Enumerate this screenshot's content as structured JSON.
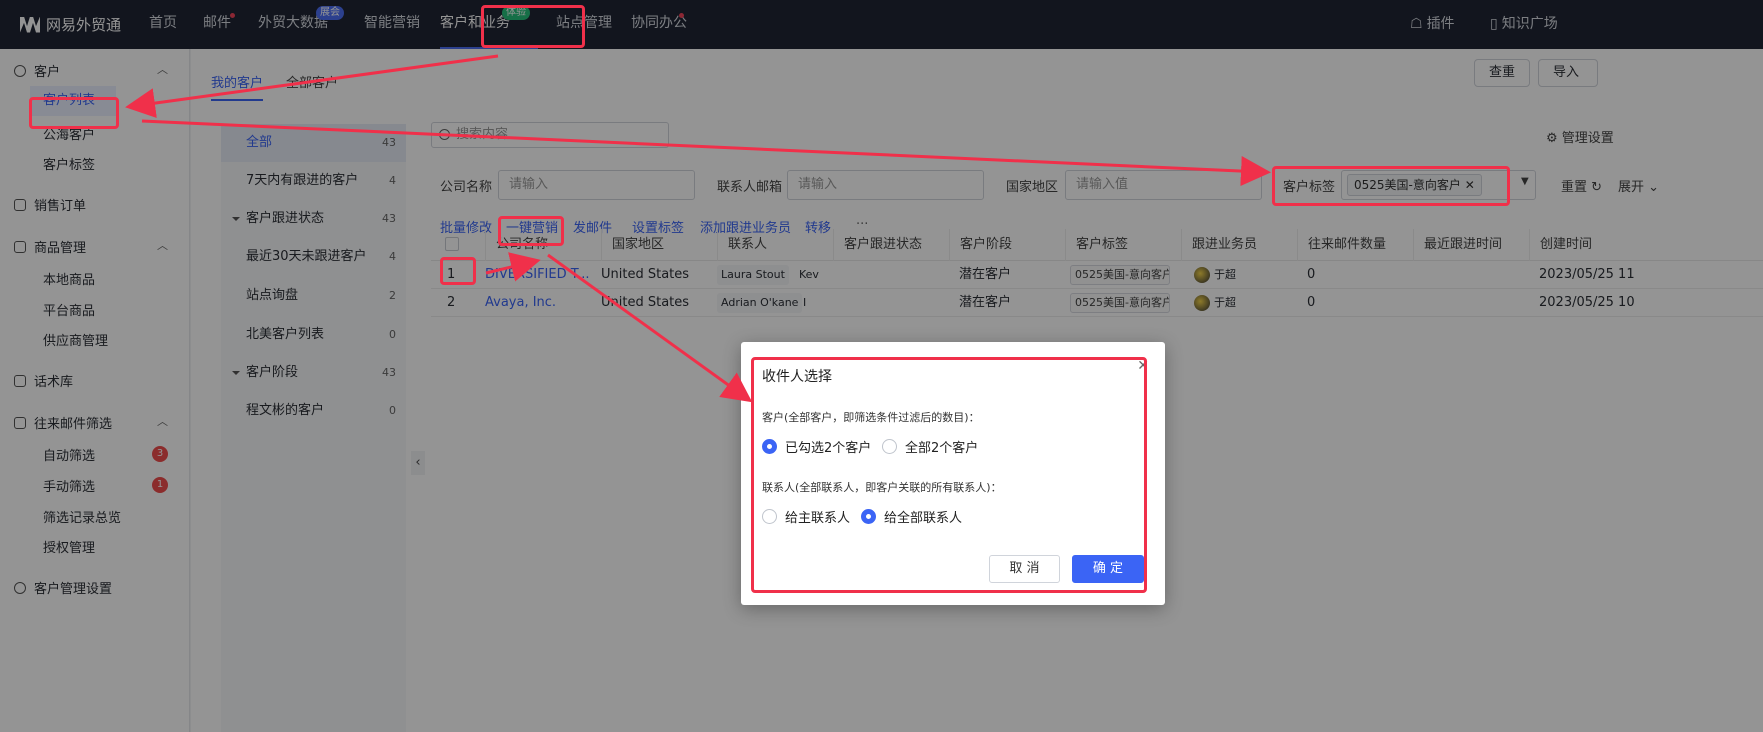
{
  "topnav": {
    "brand": "网易外贸通",
    "items": [
      {
        "label": "首页"
      },
      {
        "label": "邮件"
      },
      {
        "label": "外贸大数据",
        "badge": "展会"
      },
      {
        "label": "智能营销"
      },
      {
        "label": "客户和业务",
        "badge": "体验"
      },
      {
        "label": "站点管理"
      },
      {
        "label": "协同办公"
      }
    ],
    "right": [
      {
        "label": "插件",
        "icon": "plugin-icon"
      },
      {
        "label": "知识广场",
        "icon": "book-icon"
      }
    ]
  },
  "sidebar": {
    "groups": [
      {
        "label": "客户",
        "icon": "user-circle-icon",
        "items": [
          "客户列表",
          "公海客户",
          "客户标签"
        ]
      },
      {
        "label": "销售订单",
        "icon": "document-icon",
        "items": []
      },
      {
        "label": "商品管理",
        "icon": "box-icon",
        "items": [
          "本地商品",
          "平台商品",
          "供应商管理"
        ]
      },
      {
        "label": "话术库",
        "icon": "book-icon",
        "items": []
      },
      {
        "label": "往来邮件筛选",
        "icon": "mail-filter-icon",
        "items": [
          "自动筛选",
          "手动筛选",
          "筛选记录总览",
          "授权管理"
        ]
      },
      {
        "label": "客户管理设置",
        "icon": "gear-icon",
        "items": []
      }
    ],
    "counts": {
      "auto_filter": "3",
      "manual_filter": "1"
    }
  },
  "tabs": [
    "我的客户",
    "全部客户"
  ],
  "top_buttons": [
    "查重",
    "导入"
  ],
  "segments": [
    {
      "label": "全部",
      "count": "43"
    },
    {
      "label": "7天内有跟进的客户",
      "count": "4"
    },
    {
      "label": "客户跟进状态",
      "count": "43"
    },
    {
      "label": "最近30天未跟进客户",
      "count": "4"
    },
    {
      "label": "站点询盘",
      "count": "2"
    },
    {
      "label": "北美客户列表",
      "count": "0"
    },
    {
      "label": "客户阶段",
      "count": "43"
    },
    {
      "label": "程文彬的客户",
      "count": "0"
    }
  ],
  "search": {
    "placeholder": "搜索内容"
  },
  "manage_settings": "管理设置",
  "filters": {
    "company_label": "公司名称",
    "company_placeholder": "请输入",
    "email_label": "联系人邮箱",
    "email_placeholder": "请输入",
    "country_label": "国家地区",
    "country_placeholder": "请输入值",
    "tag_label": "客户标签",
    "tag_value": "0525美国-意向客户",
    "reset": "重置",
    "expand": "展开"
  },
  "actions": [
    "批量修改",
    "一键营销",
    "发邮件",
    "设置标签",
    "添加跟进业务员",
    "转移",
    "···"
  ],
  "table": {
    "headers": [
      "公司名称",
      "国家地区",
      "联系人",
      "客户跟进状态",
      "客户阶段",
      "客户标签",
      "跟进业务员",
      "往来邮件数量",
      "最近跟进时间",
      "创建时间"
    ],
    "rows": [
      {
        "index": "1",
        "company": "DIVERSIFIED T...",
        "country": "United States",
        "contact": "Laura Stout",
        "contact2": "Kev",
        "status": "",
        "stage": "潜在客户",
        "tag": "0525美国-意向客户",
        "owner": "于超",
        "emails": "0",
        "last": "",
        "created": "2023/05/25 11"
      },
      {
        "index": "2",
        "company": "Avaya, Inc.",
        "country": "United States",
        "contact": "Adrian O'kane",
        "contact2": "I",
        "status": "",
        "stage": "潜在客户",
        "tag": "0525美国-意向客户",
        "owner": "于超",
        "emails": "0",
        "last": "",
        "created": "2023/05/25 10"
      }
    ]
  },
  "modal": {
    "title": "收件人选择",
    "customer_label": "客户(全部客户，即筛选条件过滤后的数目)：",
    "customer_options": [
      "已勾选2个客户",
      "全部2个客户"
    ],
    "contact_label": "联系人(全部联系人，即客户关联的所有联系人)：",
    "contact_options": [
      "给主联系人",
      "给全部联系人"
    ],
    "cancel": "取 消",
    "ok": "确 定"
  },
  "colors": {
    "accent": "#3b64f5",
    "annotation": "#f0304a",
    "nav_bg": "#1f2535"
  }
}
